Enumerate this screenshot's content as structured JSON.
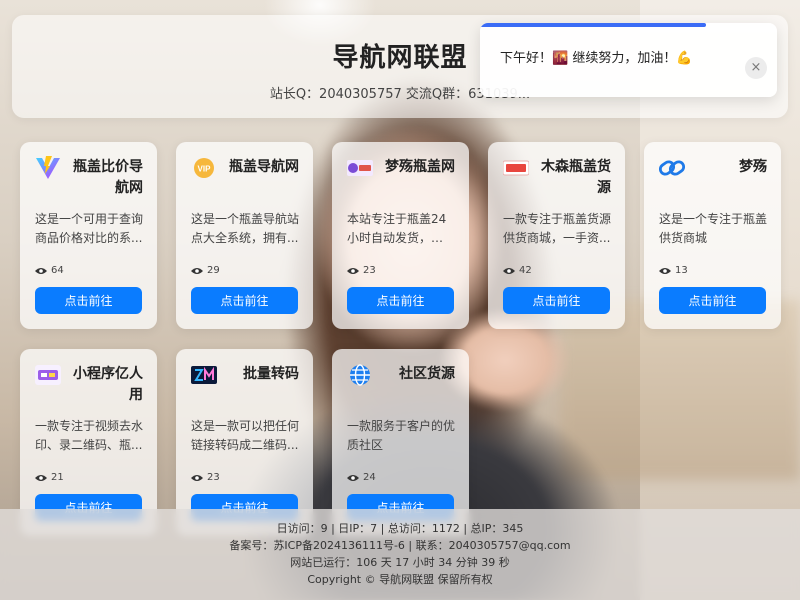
{
  "header": {
    "title": "导航网联盟",
    "subtitle": "站长Q：2040305757 交流Q群：631039..."
  },
  "toast": {
    "message": "下午好！🌇 继续努力，加油！💪",
    "close_icon": "×",
    "progress": 0.76,
    "progress_color": "#3b6cf6"
  },
  "cards": [
    {
      "title": "瓶盖比价导航网",
      "desc": "这是一个可用于查询商品价格对比的系...",
      "views": "64",
      "button": "点击前往",
      "icon": "v-logo-icon"
    },
    {
      "title": "瓶盖导航网",
      "desc": "这是一个瓶盖导航站点大全系统，拥有...",
      "views": "29",
      "button": "点击前往",
      "icon": "vip-badge-icon"
    },
    {
      "title": "梦殇瓶盖网",
      "desc": "本站专注于瓶盖24小时自动发货，一手...",
      "views": "23",
      "button": "点击前往",
      "icon": "mengshang-logo-icon"
    },
    {
      "title": "木森瓶盖货源",
      "desc": "一款专注于瓶盖货源供货商城，一手资...",
      "views": "42",
      "button": "点击前往",
      "icon": "musen-logo-icon"
    },
    {
      "title": "梦殇",
      "desc": "这是一个专注于瓶盖供货商城",
      "views": "13",
      "button": "点击前往",
      "icon": "link-icon"
    },
    {
      "title": "小程序亿人用",
      "desc": "一款专注于视频去水印、录二维码、瓶...",
      "views": "21",
      "button": "点击前往",
      "icon": "yirenyong-logo-icon"
    },
    {
      "title": "批量转码",
      "desc": "这是一款可以把任何链接转码成二维码...",
      "views": "23",
      "button": "点击前往",
      "icon": "zm-logo-icon"
    },
    {
      "title": "社区货源",
      "desc": "一款服务于客户的优质社区",
      "views": "24",
      "button": "点击前往",
      "icon": "globe-icon"
    }
  ],
  "footer": {
    "stats": "日访问：9 | 日IP：7 | 总访问：1172 | 总IP：345",
    "icp": "备案号：苏ICP备2024136111号-6 | 联系：2040305757@qq.com",
    "uptime": "网站已运行：106 天 17 小时 34 分钟 39 秒",
    "copyright": "Copyright © 导航网联盟 保留所有权"
  },
  "colors": {
    "button": "#0a7cff",
    "button_text": "#ffffff"
  }
}
